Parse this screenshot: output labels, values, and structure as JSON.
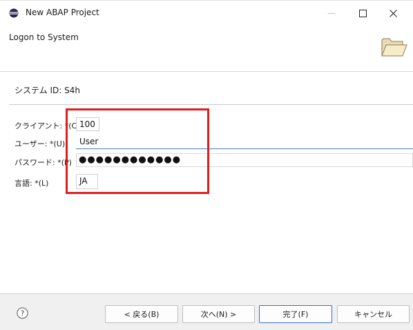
{
  "window": {
    "title": "New ABAP Project",
    "minimize_glyph": "—",
    "maximize_glyph": "☐",
    "close_glyph": "✕"
  },
  "header": {
    "title": "Logon to System",
    "banner_icon": "folder-icon"
  },
  "system": {
    "id_text": "システム ID: S4h"
  },
  "form": {
    "client_label": "クライアント: *(C)",
    "client_value": "100",
    "user_label": "ユーザー: *(U)",
    "user_value": "User",
    "password_label": "パスワード: *(P)",
    "password_value": "●●●●●●●●●●●●",
    "language_label": "言語: *(L)",
    "language_value": "JA"
  },
  "footer": {
    "help_icon": "help-icon",
    "back_label": "< 戻る(B)",
    "next_label": "次へ(N) >",
    "finish_label": "完了(F)",
    "cancel_label": "キャンセル"
  },
  "colors": {
    "highlight": "#e31b1b",
    "focus_border": "#2f6fcb",
    "user_underline": "#4a7fc1"
  }
}
